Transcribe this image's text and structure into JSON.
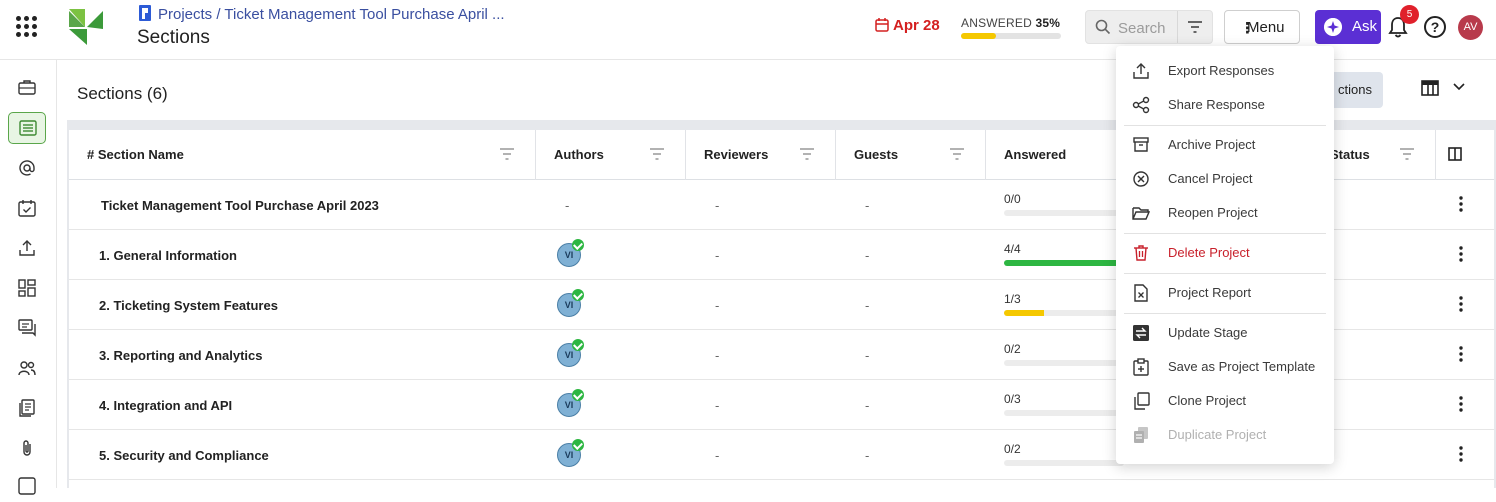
{
  "header": {
    "breadcrumb": "Projects / Ticket Management Tool Purchase April ...",
    "page_title": "Sections",
    "due_date": "Apr 28",
    "answered_label": "ANSWERED",
    "answered_pct": "35%",
    "answered_fraction": 0.35,
    "search_placeholder": "Search",
    "menu_label": "Menu",
    "ask_label": "Ask",
    "notification_count": "5",
    "help_label": "?",
    "user_initials": "AV"
  },
  "content": {
    "title": "Sections (6)",
    "sections_button": "ctions"
  },
  "table": {
    "columns": [
      "# Section Name",
      "Authors",
      "Reviewers",
      "Guests",
      "Answered",
      "Status"
    ],
    "rows": [
      {
        "name": "Ticket Management Tool Purchase April 2023",
        "author": "-",
        "reviewers": "-",
        "guests": "-",
        "answered": "0/0",
        "fraction": 0
      },
      {
        "name": "1. General Information",
        "author": "VI",
        "reviewers": "-",
        "guests": "-",
        "answered": "4/4",
        "fraction": 1.0
      },
      {
        "name": "2. Ticketing System Features",
        "author": "VI",
        "reviewers": "-",
        "guests": "-",
        "answered": "1/3",
        "fraction": 0.33
      },
      {
        "name": "3. Reporting and Analytics",
        "author": "VI",
        "reviewers": "-",
        "guests": "-",
        "answered": "0/2",
        "fraction": 0
      },
      {
        "name": "4. Integration and API",
        "author": "VI",
        "reviewers": "-",
        "guests": "-",
        "answered": "0/3",
        "fraction": 0
      },
      {
        "name": "5. Security and Compliance",
        "author": "VI",
        "reviewers": "-",
        "guests": "-",
        "answered": "0/2",
        "fraction": 0
      }
    ]
  },
  "menu": {
    "items": [
      {
        "label": "Export Responses",
        "icon": "export-icon"
      },
      {
        "label": "Share Response",
        "icon": "share-icon"
      },
      {
        "label": "Archive Project",
        "icon": "archive-icon"
      },
      {
        "label": "Cancel Project",
        "icon": "cancel-icon"
      },
      {
        "label": "Reopen Project",
        "icon": "folder-open-icon"
      },
      {
        "label": "Delete Project",
        "icon": "trash-icon"
      },
      {
        "label": "Project Report",
        "icon": "report-icon"
      },
      {
        "label": "Update Stage",
        "icon": "stage-icon"
      },
      {
        "label": "Save as Project Template",
        "icon": "template-icon"
      },
      {
        "label": "Clone Project",
        "icon": "clone-icon"
      },
      {
        "label": "Duplicate Project",
        "icon": "duplicate-icon"
      }
    ]
  },
  "colors": {
    "accent_purple": "#5b2fd4",
    "danger": "#c8202b",
    "progress_green": "#2db642",
    "progress_yellow": "#f5c800",
    "brand_green": "#5aa64a"
  }
}
